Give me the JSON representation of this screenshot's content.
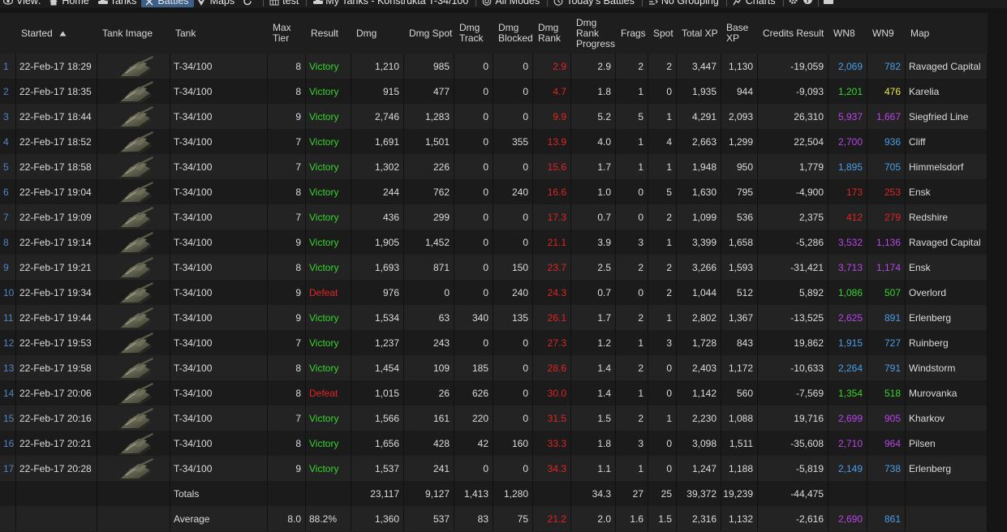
{
  "toolbar": {
    "items": [
      {
        "label": "View:",
        "icon": "eye-icon"
      },
      {
        "label": "Home",
        "icon": "home-icon"
      },
      {
        "label": "Tanks",
        "icon": "tank-icon"
      },
      {
        "label": "Battles",
        "icon": "swords-icon",
        "active": true
      },
      {
        "label": "Maps",
        "icon": "map-marker-icon"
      },
      {
        "label": "",
        "icon": "refresh-icon"
      },
      {
        "label": "test",
        "icon": "table-icon"
      },
      {
        "label": "My Tanks - Konstrukta T-34/100",
        "icon": "tank-icon"
      },
      {
        "label": "All Modes",
        "icon": "target-icon"
      },
      {
        "label": "Today's Battles",
        "icon": "clock-icon"
      },
      {
        "label": "No Grouping",
        "icon": "grouping-icon"
      },
      {
        "label": "Charts",
        "icon": "chart-icon"
      }
    ],
    "right_icons": [
      "gear-icon",
      "help-icon",
      "bag-icon"
    ]
  },
  "columns": [
    {
      "label": "",
      "key": "n"
    },
    {
      "label": "Started",
      "key": "started",
      "sorted": true
    },
    {
      "label": "Tank Image",
      "key": "img"
    },
    {
      "label": "Tank",
      "key": "tank"
    },
    {
      "label": "Max Tier",
      "key": "tier"
    },
    {
      "label": "Result",
      "key": "result"
    },
    {
      "label": "Dmg",
      "key": "dmg"
    },
    {
      "label": "Dmg Spot",
      "key": "spot"
    },
    {
      "label": "Dmg Track",
      "key": "track"
    },
    {
      "label": "Dmg Blocked",
      "key": "blocked"
    },
    {
      "label": "Dmg Rank",
      "key": "rank"
    },
    {
      "label": "Dmg Rank Progress",
      "key": "progress"
    },
    {
      "label": "Frags",
      "key": "frags"
    },
    {
      "label": "Spot",
      "key": "spotted"
    },
    {
      "label": "Total XP",
      "key": "txp"
    },
    {
      "label": "Base XP",
      "key": "bxp"
    },
    {
      "label": "Credits Result",
      "key": "credits"
    },
    {
      "label": "WN8",
      "key": "wn8"
    },
    {
      "label": "WN9",
      "key": "wn9"
    },
    {
      "label": "Map",
      "key": "map"
    }
  ],
  "rows": [
    {
      "n": "1",
      "started": "22-Feb-17 18:29",
      "tank": "T-34/100",
      "tier": "8",
      "result": "Victory",
      "dmg": "1,210",
      "spot": "985",
      "track": "0",
      "blocked": "0",
      "rank": "2.9",
      "progress": "2.9",
      "frags": "2",
      "spotted": "2",
      "txp": "3,447",
      "bxp": "1,130",
      "credits": "-19,059",
      "wn8": "2,069",
      "wn8c": "#4a9fe8",
      "wn9": "782",
      "wn9c": "#4a9fe8",
      "map": "Ravaged Capital"
    },
    {
      "n": "2",
      "started": "22-Feb-17 18:35",
      "tank": "T-34/100",
      "tier": "8",
      "result": "Victory",
      "dmg": "915",
      "spot": "477",
      "track": "0",
      "blocked": "0",
      "rank": "4.7",
      "progress": "1.8",
      "frags": "1",
      "spotted": "0",
      "txp": "1,935",
      "bxp": "944",
      "credits": "-9,093",
      "wn8": "1,201",
      "wn8c": "#37d52d",
      "wn9": "476",
      "wn9c": "#e8e84a",
      "map": "Karelia"
    },
    {
      "n": "3",
      "started": "22-Feb-17 18:44",
      "tank": "T-34/100",
      "tier": "9",
      "result": "Victory",
      "dmg": "2,746",
      "spot": "1,283",
      "track": "0",
      "blocked": "0",
      "rank": "9.9",
      "progress": "5.2",
      "frags": "5",
      "spotted": "1",
      "txp": "4,291",
      "bxp": "2,093",
      "credits": "26,310",
      "wn8": "5,937",
      "wn8c": "#b845e8",
      "wn9": "1,667",
      "wn9c": "#b845e8",
      "map": "Siegfried Line"
    },
    {
      "n": "4",
      "started": "22-Feb-17 18:52",
      "tank": "T-34/100",
      "tier": "7",
      "result": "Victory",
      "dmg": "1,691",
      "spot": "1,501",
      "track": "0",
      "blocked": "355",
      "rank": "13.9",
      "progress": "4.0",
      "frags": "1",
      "spotted": "4",
      "txp": "2,663",
      "bxp": "1,299",
      "credits": "22,504",
      "wn8": "2,700",
      "wn8c": "#b845e8",
      "wn9": "936",
      "wn9c": "#4a9fe8",
      "map": "Cliff"
    },
    {
      "n": "5",
      "started": "22-Feb-17 18:58",
      "tank": "T-34/100",
      "tier": "7",
      "result": "Victory",
      "dmg": "1,302",
      "spot": "226",
      "track": "0",
      "blocked": "0",
      "rank": "15.6",
      "progress": "1.7",
      "frags": "1",
      "spotted": "1",
      "txp": "1,948",
      "bxp": "950",
      "credits": "1,779",
      "wn8": "1,895",
      "wn8c": "#4a9fe8",
      "wn9": "705",
      "wn9c": "#4a9fe8",
      "map": "Himmelsdorf"
    },
    {
      "n": "6",
      "started": "22-Feb-17 19:04",
      "tank": "T-34/100",
      "tier": "8",
      "result": "Victory",
      "dmg": "244",
      "spot": "762",
      "track": "0",
      "blocked": "240",
      "rank": "16.6",
      "progress": "1.0",
      "frags": "0",
      "spotted": "5",
      "txp": "1,630",
      "bxp": "795",
      "credits": "-4,900",
      "wn8": "173",
      "wn8c": "#e12424",
      "wn9": "253",
      "wn9c": "#e12424",
      "map": "Ensk"
    },
    {
      "n": "7",
      "started": "22-Feb-17 19:09",
      "tank": "T-34/100",
      "tier": "7",
      "result": "Victory",
      "dmg": "436",
      "spot": "299",
      "track": "0",
      "blocked": "0",
      "rank": "17.3",
      "progress": "0.7",
      "frags": "0",
      "spotted": "2",
      "txp": "1,099",
      "bxp": "536",
      "credits": "2,375",
      "wn8": "412",
      "wn8c": "#e12424",
      "wn9": "279",
      "wn9c": "#e12424",
      "map": "Redshire"
    },
    {
      "n": "8",
      "started": "22-Feb-17 19:14",
      "tank": "T-34/100",
      "tier": "9",
      "result": "Victory",
      "dmg": "1,905",
      "spot": "1,452",
      "track": "0",
      "blocked": "0",
      "rank": "21.1",
      "progress": "3.9",
      "frags": "3",
      "spotted": "1",
      "txp": "3,399",
      "bxp": "1,658",
      "credits": "-5,286",
      "wn8": "3,532",
      "wn8c": "#b845e8",
      "wn9": "1,136",
      "wn9c": "#b845e8",
      "map": "Ravaged Capital"
    },
    {
      "n": "9",
      "started": "22-Feb-17 19:21",
      "tank": "T-34/100",
      "tier": "8",
      "result": "Victory",
      "dmg": "1,693",
      "spot": "871",
      "track": "0",
      "blocked": "150",
      "rank": "23.7",
      "progress": "2.5",
      "frags": "2",
      "spotted": "2",
      "txp": "3,266",
      "bxp": "1,593",
      "credits": "-31,421",
      "wn8": "3,713",
      "wn8c": "#b845e8",
      "wn9": "1,174",
      "wn9c": "#b845e8",
      "map": "Ensk"
    },
    {
      "n": "10",
      "started": "22-Feb-17 19:34",
      "tank": "T-34/100",
      "tier": "9",
      "result": "Defeat",
      "dmg": "976",
      "spot": "0",
      "track": "0",
      "blocked": "240",
      "rank": "24.3",
      "progress": "0.7",
      "frags": "0",
      "spotted": "2",
      "txp": "1,044",
      "bxp": "512",
      "credits": "5,892",
      "wn8": "1,086",
      "wn8c": "#37d52d",
      "wn9": "507",
      "wn9c": "#37d52d",
      "map": "Overlord"
    },
    {
      "n": "11",
      "started": "22-Feb-17 19:44",
      "tank": "T-34/100",
      "tier": "9",
      "result": "Victory",
      "dmg": "1,534",
      "spot": "63",
      "track": "340",
      "blocked": "135",
      "rank": "26.1",
      "progress": "1.7",
      "frags": "2",
      "spotted": "1",
      "txp": "2,802",
      "bxp": "1,367",
      "credits": "-13,525",
      "wn8": "2,625",
      "wn8c": "#b845e8",
      "wn9": "891",
      "wn9c": "#4a9fe8",
      "map": "Erlenberg"
    },
    {
      "n": "12",
      "started": "22-Feb-17 19:53",
      "tank": "T-34/100",
      "tier": "7",
      "result": "Victory",
      "dmg": "1,237",
      "spot": "243",
      "track": "0",
      "blocked": "0",
      "rank": "27.3",
      "progress": "1.2",
      "frags": "1",
      "spotted": "3",
      "txp": "1,728",
      "bxp": "843",
      "credits": "19,862",
      "wn8": "1,915",
      "wn8c": "#4a9fe8",
      "wn9": "727",
      "wn9c": "#4a9fe8",
      "map": "Ruinberg"
    },
    {
      "n": "13",
      "started": "22-Feb-17 19:58",
      "tank": "T-34/100",
      "tier": "8",
      "result": "Victory",
      "dmg": "1,454",
      "spot": "109",
      "track": "185",
      "blocked": "0",
      "rank": "28.6",
      "progress": "1.4",
      "frags": "2",
      "spotted": "0",
      "txp": "2,403",
      "bxp": "1,172",
      "credits": "-10,633",
      "wn8": "2,264",
      "wn8c": "#4a9fe8",
      "wn9": "791",
      "wn9c": "#4a9fe8",
      "map": "Windstorm"
    },
    {
      "n": "14",
      "started": "22-Feb-17 20:06",
      "tank": "T-34/100",
      "tier": "8",
      "result": "Defeat",
      "dmg": "1,015",
      "spot": "26",
      "track": "626",
      "blocked": "0",
      "rank": "30.0",
      "progress": "1.4",
      "frags": "1",
      "spotted": "0",
      "txp": "1,142",
      "bxp": "560",
      "credits": "-7,569",
      "wn8": "1,354",
      "wn8c": "#37d52d",
      "wn9": "518",
      "wn9c": "#37d52d",
      "map": "Murovanka"
    },
    {
      "n": "15",
      "started": "22-Feb-17 20:16",
      "tank": "T-34/100",
      "tier": "7",
      "result": "Victory",
      "dmg": "1,566",
      "spot": "161",
      "track": "220",
      "blocked": "0",
      "rank": "31.5",
      "progress": "1.5",
      "frags": "2",
      "spotted": "1",
      "txp": "2,230",
      "bxp": "1,088",
      "credits": "19,716",
      "wn8": "2,699",
      "wn8c": "#b845e8",
      "wn9": "905",
      "wn9c": "#b845e8",
      "map": "Kharkov"
    },
    {
      "n": "16",
      "started": "22-Feb-17 20:21",
      "tank": "T-34/100",
      "tier": "8",
      "result": "Victory",
      "dmg": "1,656",
      "spot": "428",
      "track": "42",
      "blocked": "160",
      "rank": "33.3",
      "progress": "1.8",
      "frags": "3",
      "spotted": "0",
      "txp": "3,098",
      "bxp": "1,511",
      "credits": "-35,608",
      "wn8": "2,710",
      "wn8c": "#b845e8",
      "wn9": "964",
      "wn9c": "#b845e8",
      "map": "Pilsen"
    },
    {
      "n": "17",
      "started": "22-Feb-17 20:28",
      "tank": "T-34/100",
      "tier": "9",
      "result": "Victory",
      "dmg": "1,537",
      "spot": "241",
      "track": "0",
      "blocked": "0",
      "rank": "34.3",
      "progress": "1.1",
      "frags": "1",
      "spotted": "0",
      "txp": "1,247",
      "bxp": "1,188",
      "credits": "-5,819",
      "wn8": "2,149",
      "wn8c": "#4a9fe8",
      "wn9": "738",
      "wn9c": "#4a9fe8",
      "map": "Erlenberg"
    }
  ],
  "totals": {
    "label": "Totals",
    "dmg": "23,117",
    "spot": "9,127",
    "track": "1,413",
    "blocked": "1,280",
    "progress": "34.3",
    "frags": "27",
    "spotted": "25",
    "txp": "39,372",
    "bxp": "19,239",
    "credits": "-44,475"
  },
  "average": {
    "label": "Average",
    "tier": "8.0",
    "result": "88.2%",
    "dmg": "1,360",
    "spot": "537",
    "track": "83",
    "blocked": "75",
    "rank": "21.2",
    "progress": "2.0",
    "frags": "1.6",
    "spotted": "1.5",
    "txp": "2,316",
    "bxp": "1,132",
    "credits": "-2,616",
    "wn8": "2,690",
    "wn8c": "#b845e8",
    "wn9": "861",
    "wn9c": "#4a9fe8"
  },
  "colors": {
    "victory": "#37d52d",
    "defeat": "#e12424",
    "rank": "#e12424",
    "row_number": "#4f86c6",
    "active_tab": "#3b5f86"
  }
}
